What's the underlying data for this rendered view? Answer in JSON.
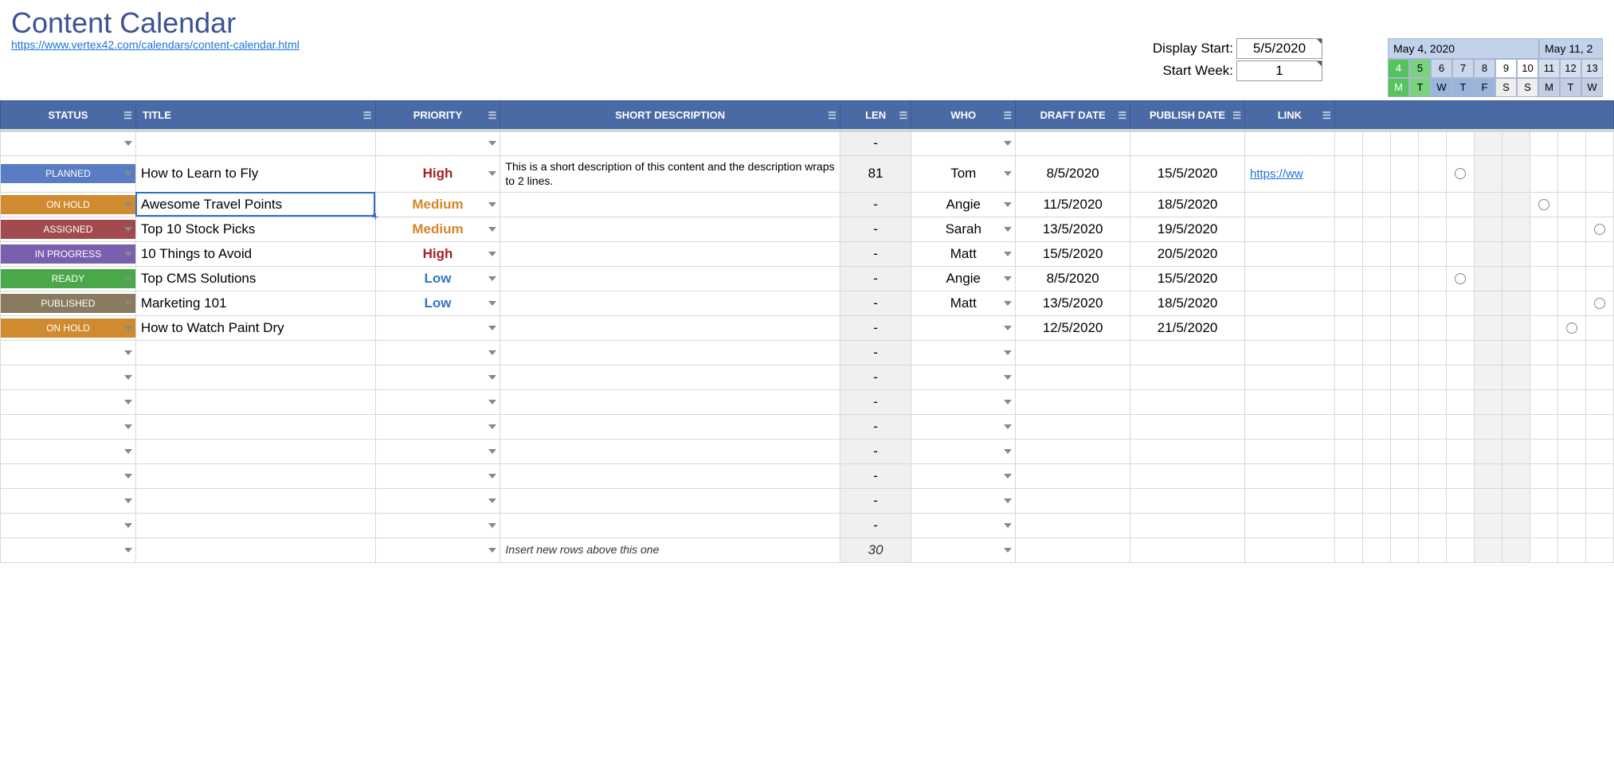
{
  "page": {
    "title": "Content Calendar",
    "source_url": "https://www.vertex42.com/calendars/content-calendar.html"
  },
  "config": {
    "display_start_label": "Display Start:",
    "display_start_value": "5/5/2020",
    "start_week_label": "Start Week:",
    "start_week_value": "1"
  },
  "weeks": [
    {
      "label": "May 4, 2020",
      "days": [
        4,
        5,
        6,
        7,
        8,
        9,
        10
      ],
      "letters": [
        "M",
        "T",
        "W",
        "T",
        "F",
        "S",
        "S"
      ]
    },
    {
      "label": "May 11, 2",
      "days": [
        11,
        12,
        13
      ],
      "letters": [
        "M",
        "T",
        "W"
      ]
    }
  ],
  "columns": {
    "status": "STATUS",
    "title": "TITLE",
    "priority": "PRIORITY",
    "desc": "SHORT DESCRIPTION",
    "len": "LEN",
    "who": "WHO",
    "draft": "DRAFT DATE",
    "publish": "PUBLISH DATE",
    "link": "LINK"
  },
  "rows": [
    {
      "status": "",
      "status_class": "",
      "title": "",
      "priority": "",
      "prio_class": "",
      "desc": "",
      "len": "-",
      "who": "",
      "draft": "",
      "publish": "",
      "link": "",
      "circles": []
    },
    {
      "status": "PLANNED",
      "status_class": "st-planned",
      "title": "How to Learn to Fly",
      "priority": "High",
      "prio_class": "prio-high",
      "desc": "This is a short description of this content and the description wraps to 2 lines.",
      "len": "81",
      "who": "Tom",
      "draft": "8/5/2020",
      "publish": "15/5/2020",
      "link": "https://ww",
      "circles": [
        8
      ],
      "tall": true
    },
    {
      "status": "ON HOLD",
      "status_class": "st-onhold",
      "title": "Awesome Travel Points",
      "priority": "Medium",
      "prio_class": "prio-medium",
      "desc": "",
      "len": "-",
      "who": "Angie",
      "draft": "11/5/2020",
      "publish": "18/5/2020",
      "link": "",
      "circles": [
        11
      ],
      "selected_title": true
    },
    {
      "status": "ASSIGNED",
      "status_class": "st-assigned",
      "title": "Top 10 Stock Picks",
      "priority": "Medium",
      "prio_class": "prio-medium",
      "desc": "",
      "len": "-",
      "who": "Sarah",
      "draft": "13/5/2020",
      "publish": "19/5/2020",
      "link": "",
      "circles": [
        13
      ]
    },
    {
      "status": "IN PROGRESS",
      "status_class": "st-inprogress",
      "title": "10 Things to Avoid",
      "priority": "High",
      "prio_class": "prio-high",
      "desc": "",
      "len": "-",
      "who": "Matt",
      "draft": "15/5/2020",
      "publish": "20/5/2020",
      "link": "",
      "circles": []
    },
    {
      "status": "READY",
      "status_class": "st-ready",
      "title": "Top CMS Solutions",
      "priority": "Low",
      "prio_class": "prio-low",
      "desc": "",
      "len": "-",
      "who": "Angie",
      "draft": "8/5/2020",
      "publish": "15/5/2020",
      "link": "",
      "circles": [
        8
      ]
    },
    {
      "status": "PUBLISHED",
      "status_class": "st-published",
      "title": "Marketing 101",
      "priority": "Low",
      "prio_class": "prio-low",
      "desc": "",
      "len": "-",
      "who": "Matt",
      "draft": "13/5/2020",
      "publish": "18/5/2020",
      "link": "",
      "circles": [
        13
      ]
    },
    {
      "status": "ON HOLD",
      "status_class": "st-onhold",
      "title": "How to Watch Paint Dry",
      "priority": "",
      "prio_class": "",
      "desc": "",
      "len": "-",
      "who": "",
      "draft": "12/5/2020",
      "publish": "21/5/2020",
      "link": "",
      "circles": [
        12
      ]
    },
    {
      "status": "",
      "status_class": "",
      "title": "",
      "priority": "",
      "prio_class": "",
      "desc": "",
      "len": "-",
      "who": "",
      "draft": "",
      "publish": "",
      "link": "",
      "circles": []
    },
    {
      "status": "",
      "status_class": "",
      "title": "",
      "priority": "",
      "prio_class": "",
      "desc": "",
      "len": "-",
      "who": "",
      "draft": "",
      "publish": "",
      "link": "",
      "circles": []
    },
    {
      "status": "",
      "status_class": "",
      "title": "",
      "priority": "",
      "prio_class": "",
      "desc": "",
      "len": "-",
      "who": "",
      "draft": "",
      "publish": "",
      "link": "",
      "circles": []
    },
    {
      "status": "",
      "status_class": "",
      "title": "",
      "priority": "",
      "prio_class": "",
      "desc": "",
      "len": "-",
      "who": "",
      "draft": "",
      "publish": "",
      "link": "",
      "circles": []
    },
    {
      "status": "",
      "status_class": "",
      "title": "",
      "priority": "",
      "prio_class": "",
      "desc": "",
      "len": "-",
      "who": "",
      "draft": "",
      "publish": "",
      "link": "",
      "circles": []
    },
    {
      "status": "",
      "status_class": "",
      "title": "",
      "priority": "",
      "prio_class": "",
      "desc": "",
      "len": "-",
      "who": "",
      "draft": "",
      "publish": "",
      "link": "",
      "circles": []
    },
    {
      "status": "",
      "status_class": "",
      "title": "",
      "priority": "",
      "prio_class": "",
      "desc": "",
      "len": "-",
      "who": "",
      "draft": "",
      "publish": "",
      "link": "",
      "circles": []
    },
    {
      "status": "",
      "status_class": "",
      "title": "",
      "priority": "",
      "prio_class": "",
      "desc": "",
      "len": "-",
      "who": "",
      "draft": "",
      "publish": "",
      "link": "",
      "circles": []
    }
  ],
  "footer_row": {
    "desc": "Insert new rows above this one",
    "len": "30"
  },
  "day_sequence": [
    4,
    5,
    6,
    7,
    8,
    9,
    10,
    11,
    12,
    13
  ]
}
